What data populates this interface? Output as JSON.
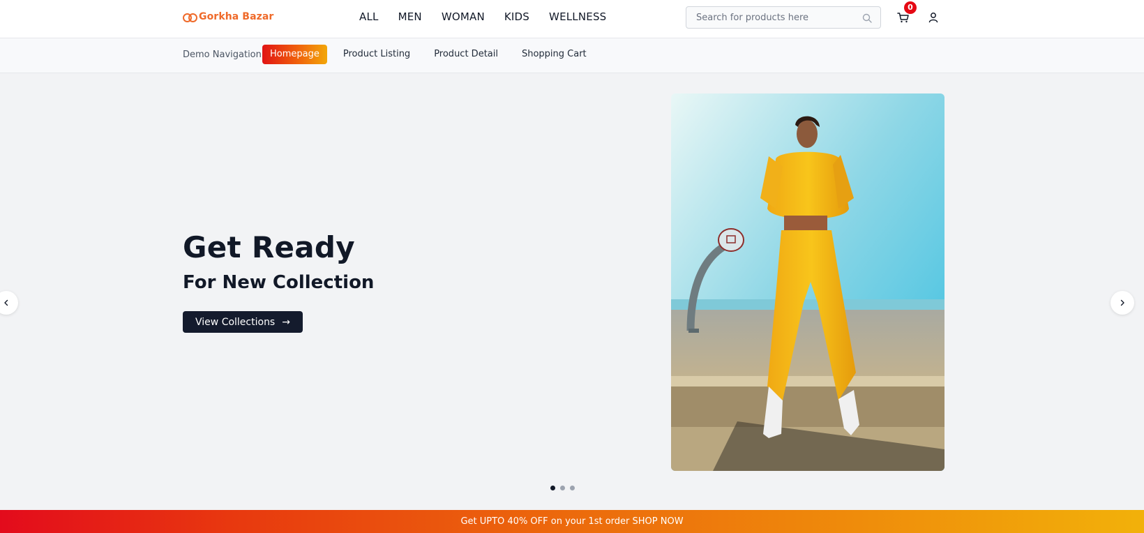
{
  "header": {
    "logo_text": "Gorkha Bazar",
    "nav": [
      "ALL",
      "MEN",
      "WOMAN",
      "KIDS",
      "WELLNESS"
    ],
    "search_placeholder": "Search for products here",
    "cart_count": "0",
    "brand_color": "#ef6a2a",
    "icons": [
      "search-icon",
      "cart-icon",
      "user-icon"
    ]
  },
  "demo_nav": {
    "label": "Demo Navigation:",
    "links": [
      "Homepage",
      "Product Listing",
      "Product Detail",
      "Shopping Cart"
    ],
    "active": "Homepage"
  },
  "hero": {
    "title": "Get Ready",
    "subtitle": "For New Collection",
    "button_label": "View Collections",
    "button_arrow": "→",
    "slide_count": 3,
    "active_slide": 1
  },
  "promo": {
    "text": "Get UPTO 40% OFF on your 1st order SHOP NOW"
  }
}
